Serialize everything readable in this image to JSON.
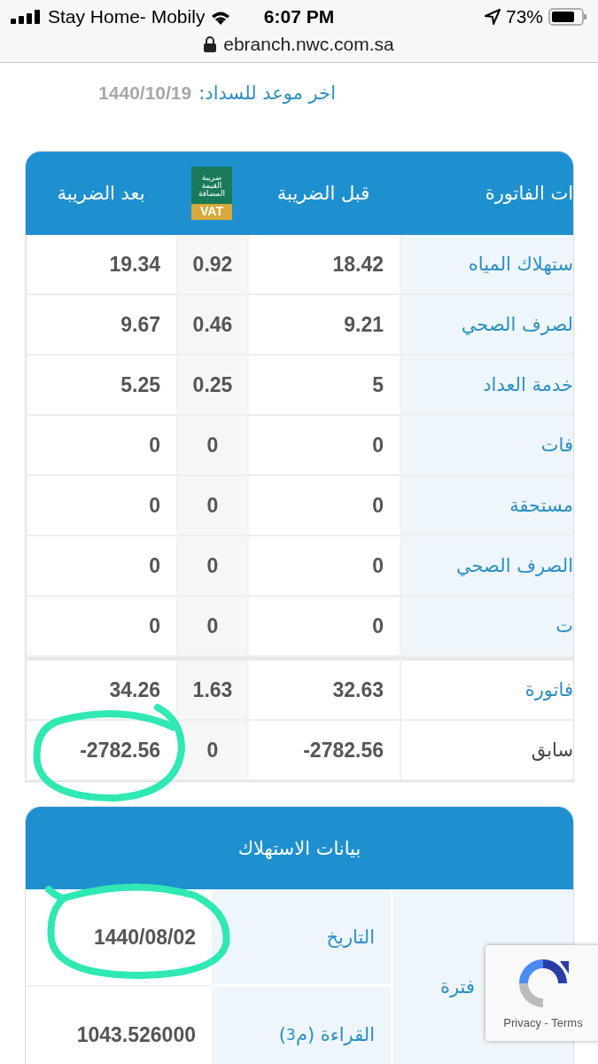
{
  "status_bar": {
    "carrier": "Stay Home- Mobily",
    "time": "6:07 PM",
    "battery": "73%"
  },
  "address_bar": {
    "url": "ebranch.nwc.com.sa"
  },
  "due_date": {
    "label": "اخر موعد للسداد:",
    "value": "1440/10/19"
  },
  "bill_table": {
    "columns": [
      "ات الفاتورة",
      "قبل الضريبة",
      "بعد الضريبة"
    ],
    "vat_logo": {
      "lines": [
        "ضريبة",
        "القيمة",
        "المضافة"
      ],
      "badge": "VAT"
    },
    "rows": [
      {
        "kind": "item",
        "label": "ستهلاك المياه",
        "before": "18.42",
        "vat": "0.92",
        "after": "19.34"
      },
      {
        "kind": "item",
        "label": "لصرف الصحي",
        "before": "9.21",
        "vat": "0.46",
        "after": "9.67"
      },
      {
        "kind": "item",
        "label": "خدمة العداد",
        "before": "5",
        "vat": "0.25",
        "after": "5.25"
      },
      {
        "kind": "item",
        "label": "فات",
        "before": "0",
        "vat": "0",
        "after": "0"
      },
      {
        "kind": "item",
        "label": "مستحقة",
        "before": "0",
        "vat": "0",
        "after": "0"
      },
      {
        "kind": "item",
        "label": "الصرف الصحي",
        "before": "0",
        "vat": "0",
        "after": "0"
      },
      {
        "kind": "item",
        "label": "ت",
        "before": "0",
        "vat": "0",
        "after": "0"
      },
      {
        "kind": "total",
        "label": "فاتورة",
        "before": "32.63",
        "vat": "1.63",
        "after": "34.26"
      },
      {
        "kind": "previous",
        "label": "سابق",
        "before": "-2782.56",
        "vat": "0",
        "after": "-2782.56"
      }
    ]
  },
  "consumption": {
    "title": "بيانات الاستهلاك",
    "period_label": "فترة",
    "rows": [
      {
        "label": "التاريخ",
        "value": "1440/08/02"
      },
      {
        "label": "القراءة (م$^{3}$)",
        "value": "1043.526000"
      }
    ]
  },
  "recaptcha": {
    "links": "Privacy - Terms"
  }
}
